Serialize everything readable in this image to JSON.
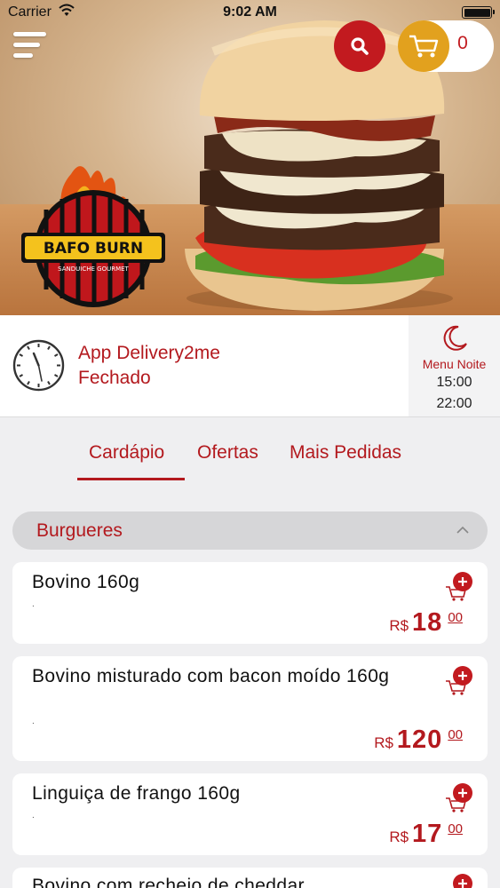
{
  "status_bar": {
    "carrier": "Carrier",
    "time": "9:02 AM"
  },
  "header": {
    "cart_count": "0",
    "brand_logo_text": "BAFO BURN",
    "brand_logo_subtext": "SANDUICHE GOURMET"
  },
  "store": {
    "name": "App Delivery2me",
    "status": "Fechado",
    "menu_label": "Menu Noite",
    "open_time": "15:00",
    "close_time": "22:00"
  },
  "tabs": [
    {
      "label": "Cardápio",
      "active": true
    },
    {
      "label": "Ofertas",
      "active": false
    },
    {
      "label": "Mais Pedidas",
      "active": false
    }
  ],
  "category": {
    "label": "Burgueres"
  },
  "products": [
    {
      "name": "Bovino 160g",
      "desc": ".",
      "currency": "R$",
      "price_int": "18",
      "price_cents": "00"
    },
    {
      "name": "Bovino misturado com bacon moído 160g",
      "desc": ".",
      "currency": "R$",
      "price_int": "120",
      "price_cents": "00"
    },
    {
      "name": "Linguiça de frango 160g",
      "desc": ".",
      "currency": "R$",
      "price_int": "17",
      "price_cents": "00"
    },
    {
      "name": "Bovino com recheio de cheddar"
    }
  ],
  "colors": {
    "brand_red": "#b3191e",
    "search_red": "#c21a1f",
    "cart_yellow": "#e2a11e"
  }
}
